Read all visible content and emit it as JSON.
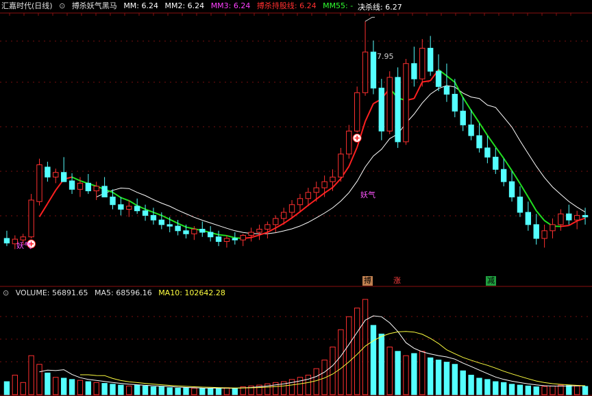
{
  "header": {
    "title": "汇嘉时代(日线)",
    "indicator_name": "搏杀妖气黑马",
    "mm": "MM: 6.24",
    "mm2": "MM2: 6.24",
    "mm3": "MM3: 6.24",
    "hold_line": "搏杀持股线: 6.24",
    "mm55": "MM55: -",
    "kill_line": "决杀线: 6.27"
  },
  "volume_header": {
    "volume": "VOLUME: 56891.65",
    "ma5": "MA5: 68596.16",
    "ma10": "MA10: 102642.28"
  },
  "annotations": {
    "high_label": "7.95",
    "signal_1": "妖气",
    "signal_2": "妖气",
    "tag_bo": "搏",
    "tag_zhang": "涨",
    "tag_jian": "减"
  },
  "colors": {
    "up": "#ff3030",
    "down": "#54ffff",
    "ma_hold_up": "#ff2020",
    "ma_hold_down": "#20e020",
    "kill_line": "#ffffff",
    "mm_white": "#ffffff",
    "mm2_yellow": "#ffff40",
    "mm3_magenta": "#ff40ff",
    "hold_red": "#ff3030",
    "mm55_green": "#30ff30",
    "vol_ma5": "#ffffff",
    "vol_ma10": "#ffff40",
    "tag_bo_bg": "#c08050",
    "tag_zhang_bg": "#d04040",
    "tag_jian_bg": "#20a040"
  },
  "chart_data": {
    "type": "candlestick",
    "title": "汇嘉时代(日线)",
    "price_range_visible": [
      4.7,
      8.05
    ],
    "period_high": 7.95,
    "ohlc": [
      [
        5.12,
        5.22,
        5.02,
        5.06
      ],
      [
        5.05,
        5.16,
        4.98,
        5.11
      ],
      [
        5.1,
        5.18,
        5.04,
        5.14
      ],
      [
        5.14,
        5.7,
        5.12,
        5.62
      ],
      [
        5.6,
        6.16,
        5.55,
        6.08
      ],
      [
        6.05,
        6.12,
        5.86,
        5.92
      ],
      [
        5.92,
        6.03,
        5.84,
        5.98
      ],
      [
        5.98,
        6.18,
        5.9,
        5.86
      ],
      [
        5.87,
        5.97,
        5.7,
        5.76
      ],
      [
        5.76,
        5.92,
        5.66,
        5.84
      ],
      [
        5.84,
        5.96,
        5.7,
        5.74
      ],
      [
        5.74,
        5.86,
        5.62,
        5.8
      ],
      [
        5.8,
        5.92,
        5.7,
        5.66
      ],
      [
        5.66,
        5.76,
        5.5,
        5.56
      ],
      [
        5.56,
        5.66,
        5.42,
        5.5
      ],
      [
        5.5,
        5.62,
        5.4,
        5.54
      ],
      [
        5.54,
        5.64,
        5.44,
        5.48
      ],
      [
        5.48,
        5.56,
        5.35,
        5.42
      ],
      [
        5.42,
        5.52,
        5.3,
        5.36
      ],
      [
        5.36,
        5.46,
        5.24,
        5.3
      ],
      [
        5.3,
        5.4,
        5.2,
        5.28
      ],
      [
        5.28,
        5.36,
        5.16,
        5.22
      ],
      [
        5.22,
        5.3,
        5.12,
        5.18
      ],
      [
        5.18,
        5.28,
        5.1,
        5.24
      ],
      [
        5.24,
        5.34,
        5.14,
        5.2
      ],
      [
        5.2,
        5.28,
        5.08,
        5.14
      ],
      [
        5.14,
        5.22,
        5.02,
        5.08
      ],
      [
        5.08,
        5.16,
        5.0,
        5.12
      ],
      [
        5.12,
        5.2,
        5.04,
        5.1
      ],
      [
        5.1,
        5.18,
        5.02,
        5.16
      ],
      [
        5.16,
        5.26,
        5.08,
        5.2
      ],
      [
        5.2,
        5.3,
        5.1,
        5.24
      ],
      [
        5.24,
        5.34,
        5.12,
        5.3
      ],
      [
        5.3,
        5.42,
        5.2,
        5.38
      ],
      [
        5.38,
        5.52,
        5.3,
        5.46
      ],
      [
        5.46,
        5.62,
        5.38,
        5.56
      ],
      [
        5.56,
        5.7,
        5.46,
        5.64
      ],
      [
        5.64,
        5.78,
        5.54,
        5.72
      ],
      [
        5.72,
        5.86,
        5.6,
        5.78
      ],
      [
        5.78,
        5.94,
        5.66,
        5.86
      ],
      [
        5.86,
        6.02,
        5.74,
        5.92
      ],
      [
        5.92,
        6.3,
        5.86,
        6.22
      ],
      [
        6.22,
        6.6,
        6.16,
        6.52
      ],
      [
        6.52,
        7.1,
        6.5,
        7.02
      ],
      [
        7.02,
        7.95,
        6.98,
        7.55
      ],
      [
        7.55,
        7.7,
        7.0,
        7.08
      ],
      [
        7.08,
        7.2,
        6.4,
        6.52
      ],
      [
        6.52,
        7.3,
        6.48,
        7.22
      ],
      [
        7.22,
        7.35,
        6.3,
        6.38
      ],
      [
        6.38,
        7.46,
        6.34,
        7.4
      ],
      [
        7.4,
        7.62,
        7.1,
        7.2
      ],
      [
        7.2,
        7.72,
        7.1,
        7.6
      ],
      [
        7.6,
        7.76,
        7.24,
        7.3
      ],
      [
        7.3,
        7.52,
        7.04,
        7.1
      ],
      [
        7.1,
        7.4,
        6.9,
        7.0
      ],
      [
        7.0,
        7.2,
        6.7,
        6.78
      ],
      [
        6.78,
        6.96,
        6.52,
        6.6
      ],
      [
        6.6,
        6.8,
        6.4,
        6.46
      ],
      [
        6.46,
        6.62,
        6.24,
        6.3
      ],
      [
        6.3,
        6.46,
        6.1,
        6.18
      ],
      [
        6.18,
        6.3,
        5.96,
        6.02
      ],
      [
        6.02,
        6.16,
        5.8,
        5.86
      ],
      [
        5.86,
        6.0,
        5.6,
        5.66
      ],
      [
        5.66,
        5.8,
        5.4,
        5.46
      ],
      [
        5.46,
        5.6,
        5.22,
        5.3
      ],
      [
        5.3,
        5.44,
        5.04,
        5.12
      ],
      [
        5.12,
        5.3,
        5.0,
        5.22
      ],
      [
        5.22,
        5.38,
        5.12,
        5.3
      ],
      [
        5.3,
        5.5,
        5.22,
        5.44
      ],
      [
        5.44,
        5.56,
        5.3,
        5.36
      ],
      [
        5.36,
        5.48,
        5.24,
        5.42
      ],
      [
        5.42,
        5.52,
        5.3,
        5.4
      ]
    ],
    "volume": [
      30,
      45,
      28,
      90,
      70,
      50,
      40,
      38,
      35,
      33,
      30,
      28,
      26,
      24,
      22,
      20,
      22,
      20,
      18,
      18,
      16,
      15,
      16,
      15,
      14,
      15,
      14,
      16,
      15,
      18,
      20,
      22,
      25,
      28,
      30,
      35,
      40,
      45,
      60,
      80,
      110,
      150,
      180,
      200,
      220,
      160,
      140,
      110,
      100,
      90,
      95,
      100,
      85,
      80,
      75,
      70,
      55,
      45,
      38,
      35,
      30,
      28,
      24,
      22,
      20,
      18,
      19,
      20,
      22,
      21,
      20,
      19
    ],
    "price_ma": {
      "legend": [
        "MM",
        "MM2",
        "MM3",
        "搏杀持股线",
        "MM55",
        "决杀线"
      ]
    },
    "volume_ma": {
      "legend": [
        "MA5",
        "MA10"
      ]
    },
    "signals": [
      {
        "index": 3,
        "label": "妖气"
      },
      {
        "index": 43,
        "label": "妖气"
      }
    ]
  }
}
